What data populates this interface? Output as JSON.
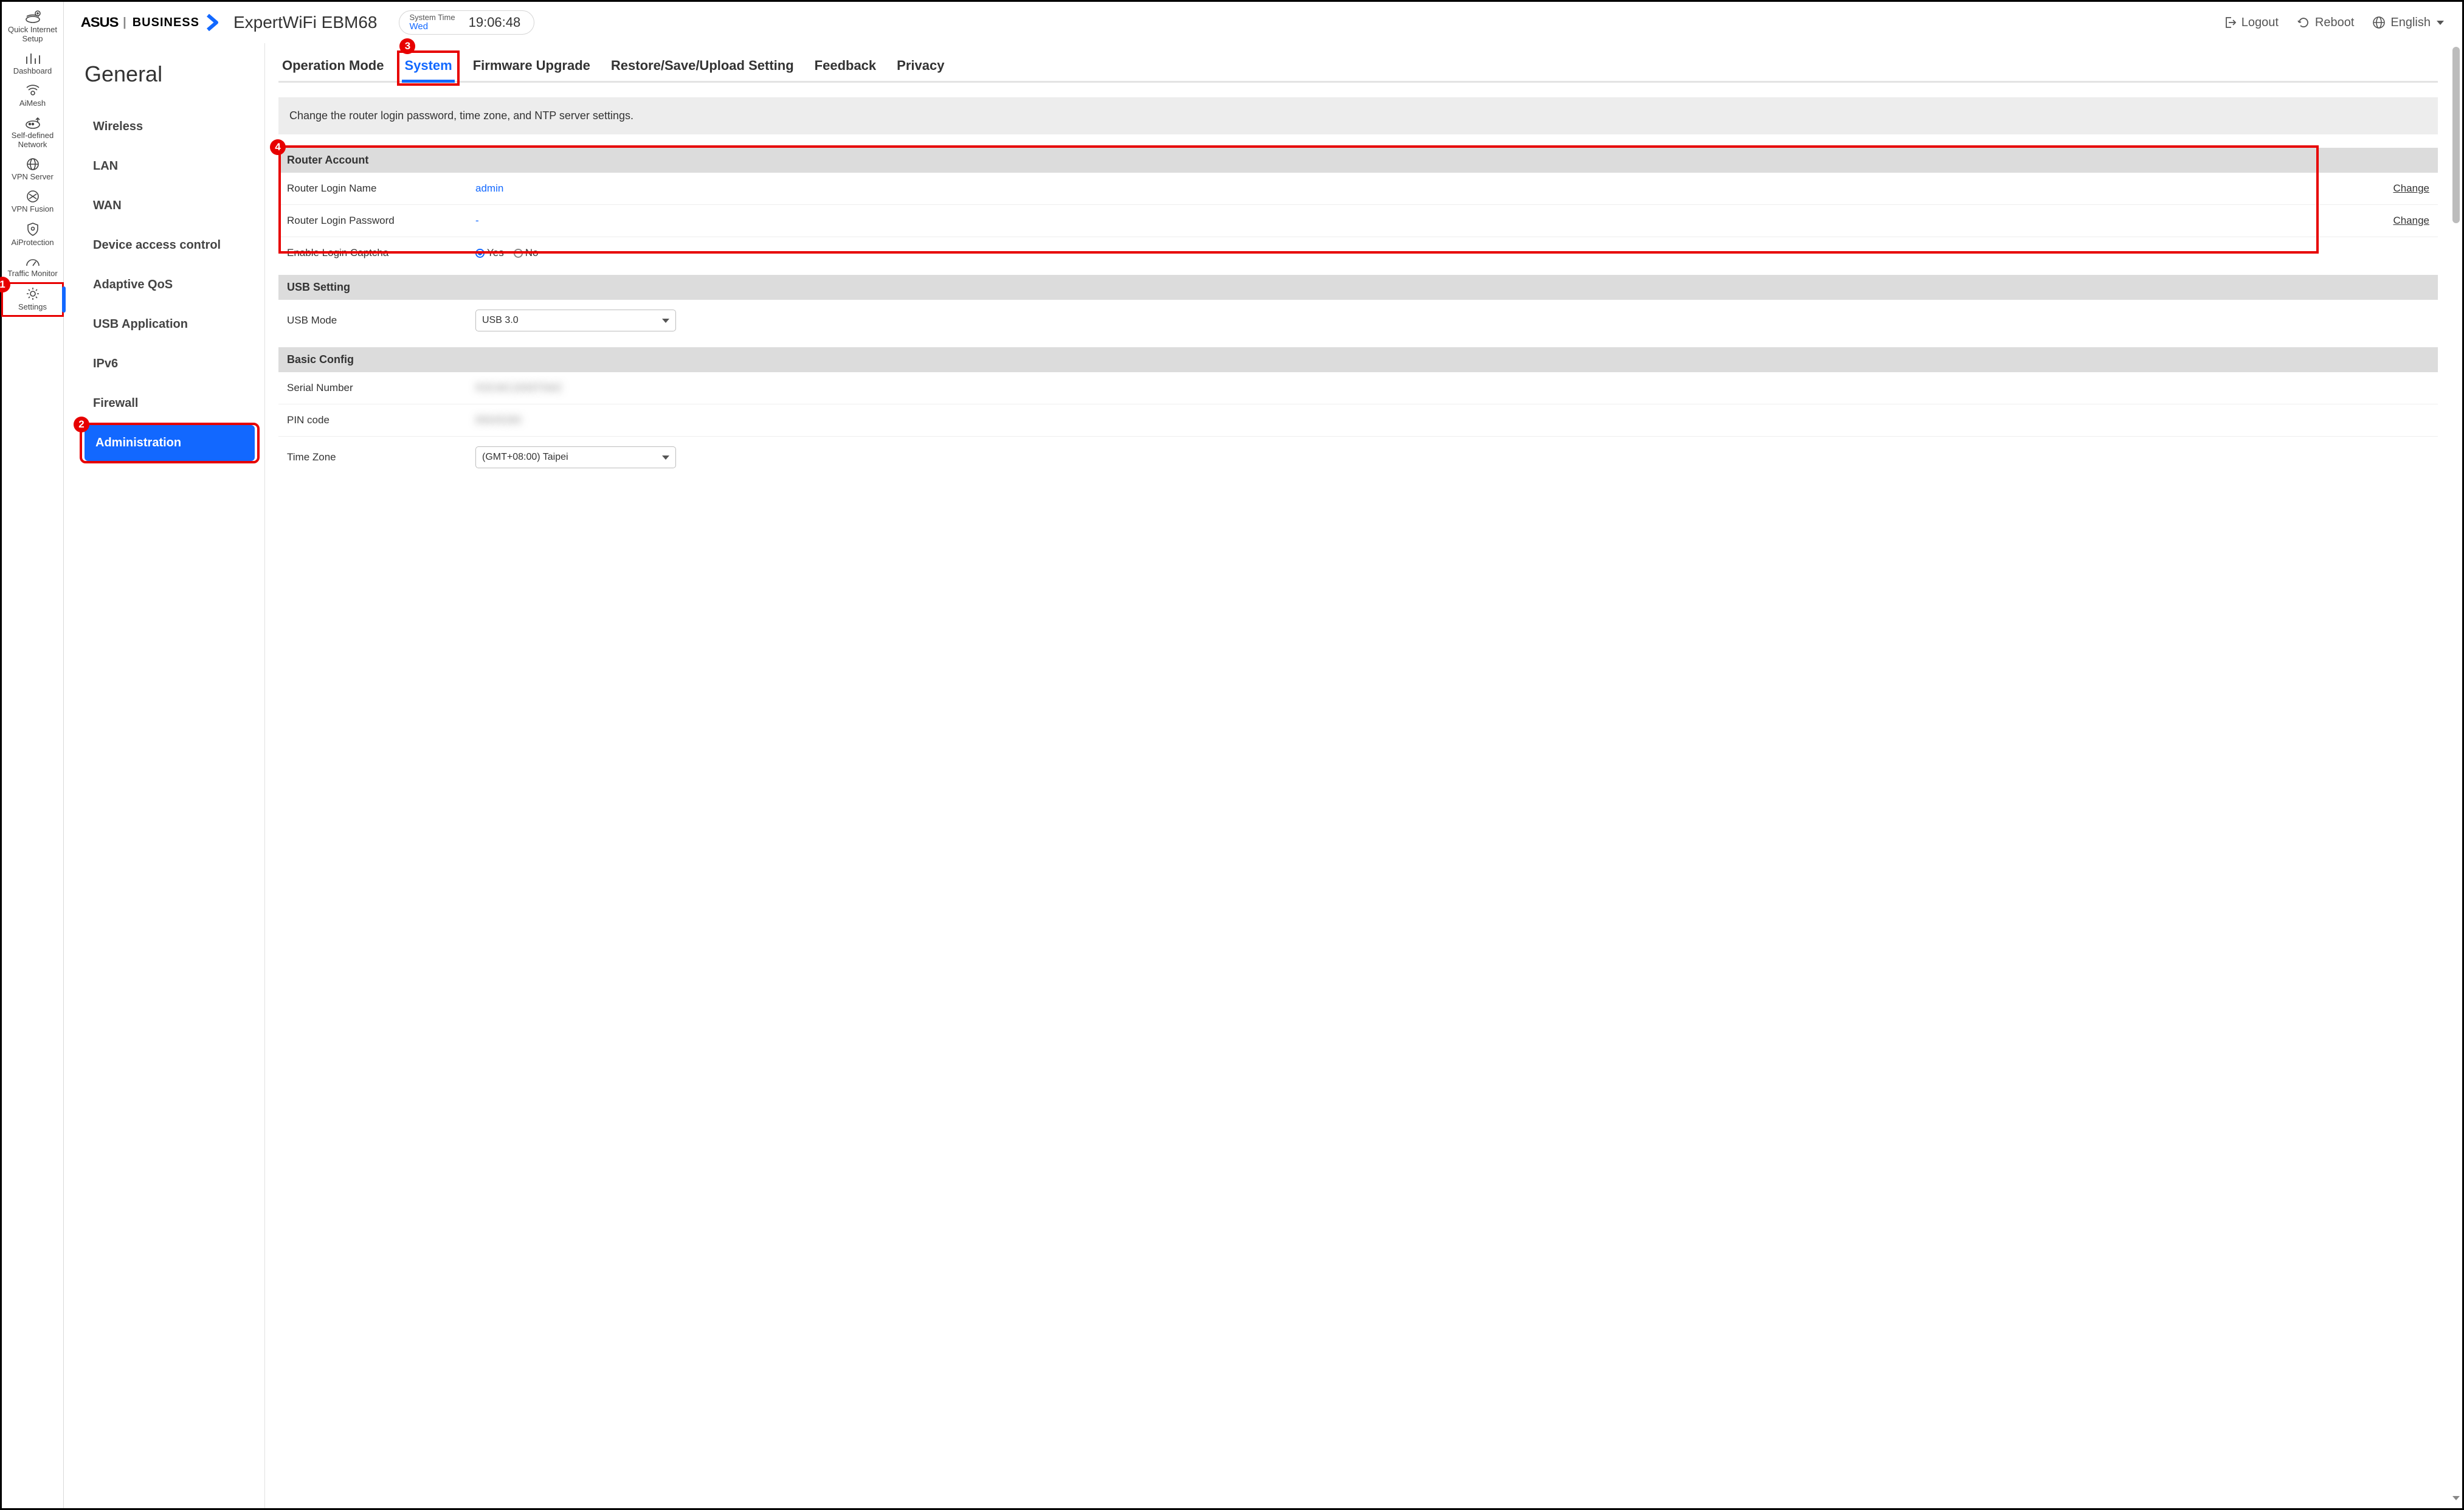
{
  "brand": {
    "asus": "ASUS",
    "business": "BUSINESS"
  },
  "product_name": "ExpertWiFi EBM68",
  "system_time": {
    "label": "System Time",
    "day": "Wed",
    "value": "19:06:48"
  },
  "top_actions": {
    "logout": "Logout",
    "reboot": "Reboot",
    "language": "English"
  },
  "icon_sidebar": [
    {
      "label": "Quick Internet Setup"
    },
    {
      "label": "Dashboard"
    },
    {
      "label": "AiMesh"
    },
    {
      "label": "Self-defined Network"
    },
    {
      "label": "VPN Server"
    },
    {
      "label": "VPN Fusion"
    },
    {
      "label": "AiProtection"
    },
    {
      "label": "Traffic Monitor"
    },
    {
      "label": "Settings"
    }
  ],
  "side_panel": {
    "title": "General",
    "items": [
      "Wireless",
      "LAN",
      "WAN",
      "Device access control",
      "Adaptive QoS",
      "USB Application",
      "IPv6",
      "Firewall",
      "Administration"
    ]
  },
  "tabs": [
    "Operation Mode",
    "System",
    "Firmware Upgrade",
    "Restore/Save/Upload Setting",
    "Feedback",
    "Privacy"
  ],
  "info_banner": "Change the router login password, time zone, and NTP server settings.",
  "section_router_account": {
    "title": "Router Account",
    "login_name_label": "Router Login Name",
    "login_name_value": "admin",
    "login_name_action": "Change",
    "login_pw_label": "Router Login Password",
    "login_pw_value": "-",
    "login_pw_action": "Change",
    "captcha_label": "Enable Login Captcha",
    "captcha_yes": "Yes",
    "captcha_no": "No"
  },
  "section_usb": {
    "title": "USB Setting",
    "mode_label": "USB Mode",
    "mode_value": "USB 3.0"
  },
  "section_basic": {
    "title": "Basic Config",
    "serial_label": "Serial Number",
    "serial_value": "R3CMC2009T5MZ",
    "pin_label": "PIN code",
    "pin_value": "85645280",
    "tz_label": "Time Zone",
    "tz_value": "(GMT+08:00) Taipei"
  },
  "annotations": {
    "b1": "1",
    "b2": "2",
    "b3": "3",
    "b4": "4"
  }
}
